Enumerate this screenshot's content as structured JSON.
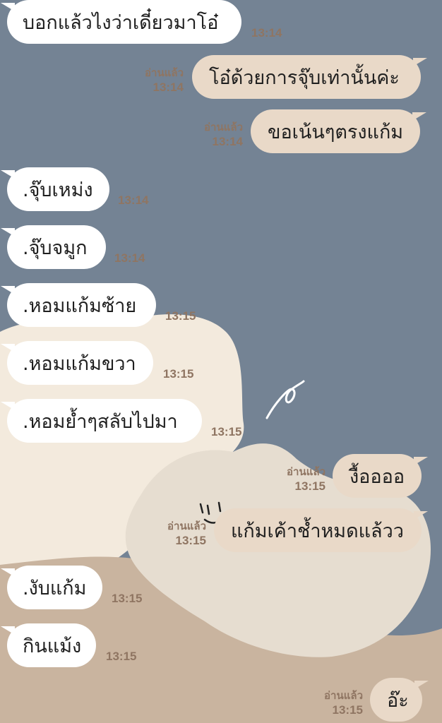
{
  "read_label": "อ่านแล้ว",
  "colors": {
    "background": "#748394",
    "incoming_bubble": "#ffffff",
    "outgoing_bubble": "#e9d9c8",
    "meta_text": "#8f7562"
  },
  "messages": [
    {
      "side": "in",
      "text": "บอกแล้วไงว่าเดี๋ยวมาโอ๋",
      "time": "13:14"
    },
    {
      "side": "out",
      "text": "โอ๋ด้วยการจุ๊บเท่านั้นค่ะ",
      "time": "13:14",
      "read": true
    },
    {
      "side": "out",
      "text": "ขอเน้นๆตรงแก้ม",
      "time": "13:14",
      "read": true
    },
    {
      "side": "in",
      "text": ".จุ๊บเหม่ง",
      "time": "13:14"
    },
    {
      "side": "in",
      "text": ".จุ๊บจมูก",
      "time": "13:14"
    },
    {
      "side": "in",
      "text": ".หอมแก้มซ้าย",
      "time": "13:15"
    },
    {
      "side": "in",
      "text": ".หอมแก้มขวา",
      "time": "13:15"
    },
    {
      "side": "in",
      "text": ".หอมย้ำๆสลับไปมา",
      "time": "13:15"
    },
    {
      "side": "out",
      "text": "งื้ออออ",
      "time": "13:15",
      "read": true
    },
    {
      "side": "out",
      "text": "แก้มเค้าช้ำหมดแล้วว",
      "time": "13:15",
      "read": true
    },
    {
      "side": "in",
      "text": ".งับแก้ม",
      "time": "13:15"
    },
    {
      "side": "in",
      "text": "กินแม้ง",
      "time": "13:15"
    },
    {
      "side": "out",
      "text": "อ๊ะ",
      "time": "13:15",
      "read": true
    }
  ]
}
